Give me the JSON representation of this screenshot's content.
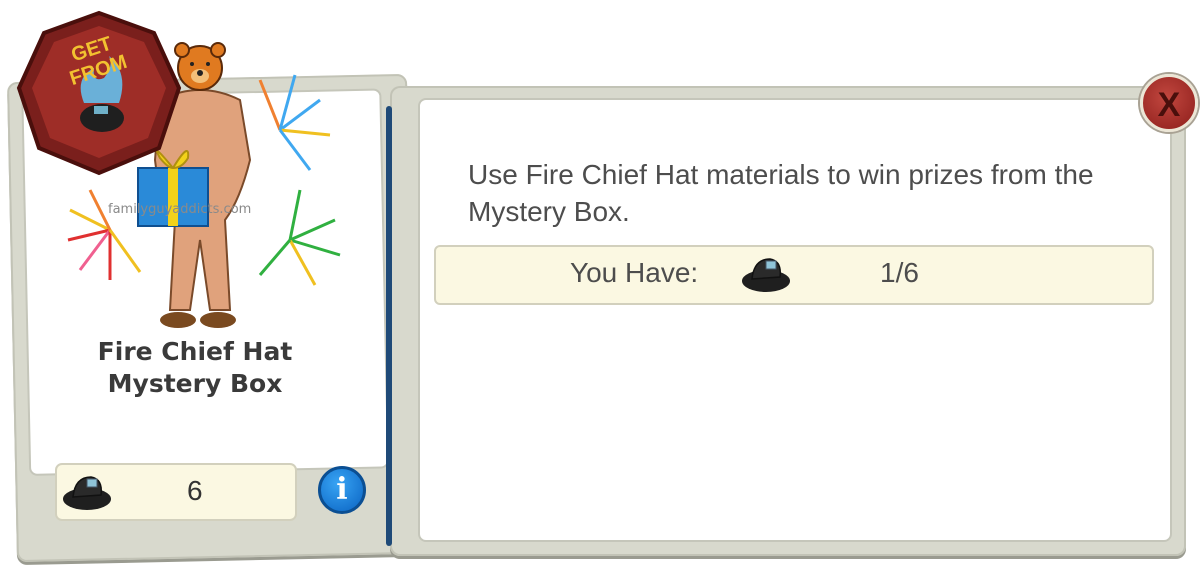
{
  "badge": {
    "text_line1": "GET",
    "text_line2": "FROM"
  },
  "item": {
    "title": "Fire Chief Hat Mystery Box",
    "watermark": "familyguyaddicts.com",
    "material_count": "6",
    "info_label": "i"
  },
  "panel": {
    "description": "Use Fire Chief Hat materials to win prizes from the Mystery Box.",
    "you_have_label": "You Have:",
    "you_have_count": "1/6"
  },
  "close_label": "X",
  "icons": {
    "badge": "get-from-badge",
    "material": "fire-chief-hat-icon",
    "info": "info-icon",
    "close": "close-icon"
  },
  "colors": {
    "badge_red": "#7a1f1c",
    "info_blue": "#1a7fe0",
    "close_red": "#b0332d",
    "counter_bg": "#fbf8e2",
    "panel_gray": "#d8d9cd"
  }
}
